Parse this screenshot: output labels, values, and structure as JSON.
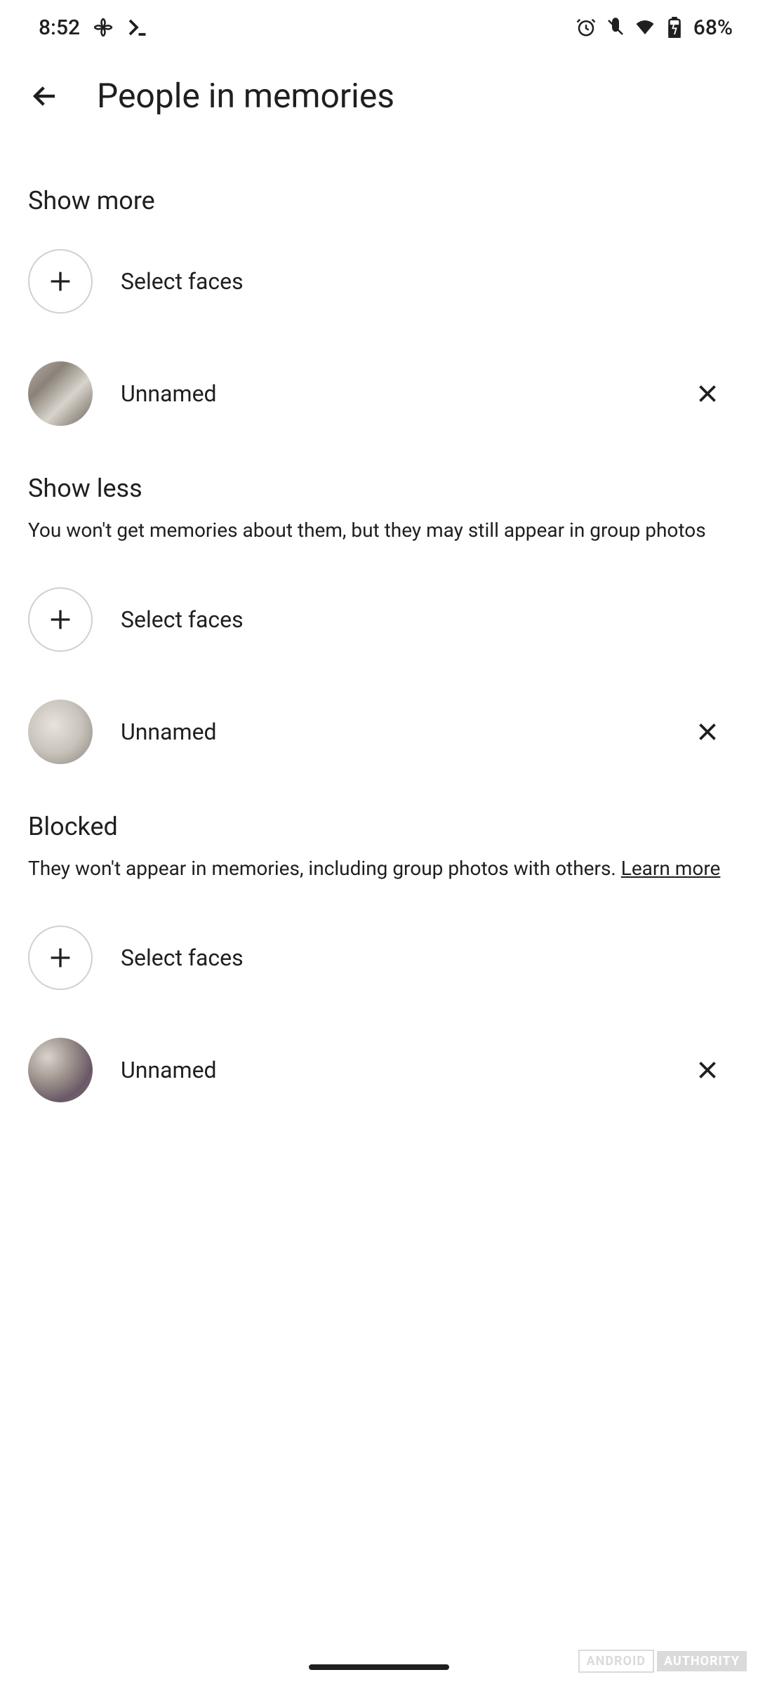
{
  "statusBar": {
    "time": "8:52",
    "battery": "68%"
  },
  "header": {
    "title": "People in memories"
  },
  "sections": {
    "showMore": {
      "title": "Show more",
      "selectFaces": "Select faces",
      "item": "Unnamed"
    },
    "showLess": {
      "title": "Show less",
      "description": "You won't get memories about them, but they may still appear in group photos",
      "selectFaces": "Select faces",
      "item": "Unnamed"
    },
    "blocked": {
      "title": "Blocked",
      "descriptionPrefix": "They won't appear in memories, including group photos with others. ",
      "learnMore": "Learn more",
      "selectFaces": "Select faces",
      "item": "Unnamed"
    }
  },
  "watermark": {
    "left": "ANDROID",
    "right": "AUTHORITY"
  }
}
